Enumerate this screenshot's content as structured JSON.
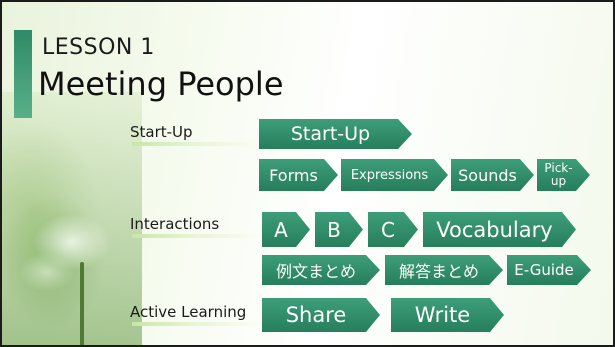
{
  "header": {
    "lesson_label": "LESSON 1",
    "title": "Meeting People"
  },
  "sections": {
    "startup": {
      "label": "Start-Up"
    },
    "interactions": {
      "label": "Interactions"
    },
    "active_learning": {
      "label": "Active Learning"
    }
  },
  "buttons": {
    "startup": "Start-Up",
    "forms": "Forms",
    "expressions": "Expressions",
    "sounds": "Sounds",
    "pickup_line1": "Pick-",
    "pickup_line2": "up",
    "a": "A",
    "b": "B",
    "c": "C",
    "vocabulary": "Vocabulary",
    "example_sentences": "例文まとめ",
    "answers": "解答まとめ",
    "eguide": "E-Guide",
    "share": "Share",
    "write": "Write"
  },
  "colors": {
    "button_green": "#2f8b68",
    "title_bar": "#3d9a73"
  }
}
